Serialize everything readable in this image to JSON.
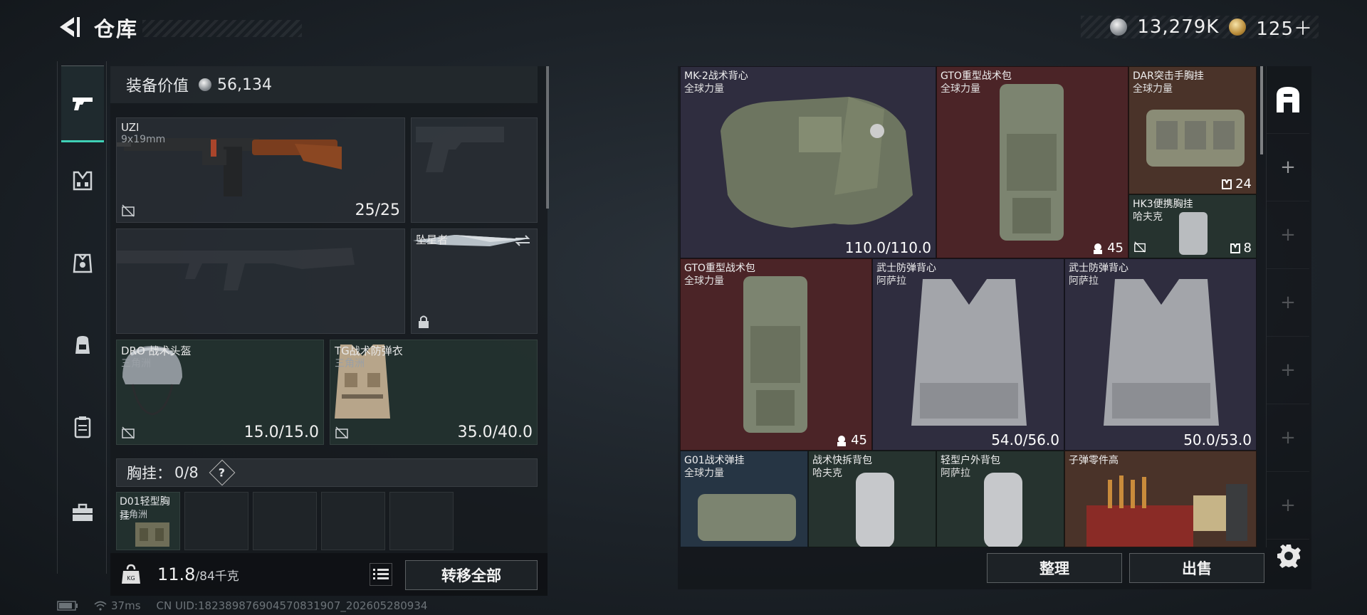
{
  "header": {
    "title": "仓库"
  },
  "currency": {
    "silver": "13,279K",
    "gold": "125＋"
  },
  "loadout": {
    "equip_value_label": "装备价值",
    "equip_value": "56,134",
    "primary": {
      "name": "UZI",
      "caliber": "9x19mm",
      "ammo": "25/25"
    },
    "melee": {
      "name": "坠星者"
    },
    "helmet": {
      "name": "DRO 战术头盔",
      "maker": "三角洲",
      "durability": "15.0/15.0"
    },
    "armor": {
      "name": "TG战术防弹衣",
      "maker": "三角洲",
      "durability": "35.0/40.0"
    },
    "chest_rig": {
      "label": "胸挂：",
      "capacity": "0/8",
      "help": "?"
    },
    "chest_item": {
      "name": "D01轻型胸挂",
      "maker": "三角洲"
    },
    "weight": {
      "current": "11.8",
      "max": "/84千克"
    },
    "transfer_all": "转移全部"
  },
  "stash": {
    "items": [
      {
        "name": "MK-2战术背心",
        "maker": "全球力量",
        "value": "110.0/110.0"
      },
      {
        "name": "GTO重型战术包",
        "maker": "全球力量",
        "value": "45"
      },
      {
        "name": "DAR突击手胸挂",
        "maker": "全球力量",
        "value": "24"
      },
      {
        "name": "HK3便携胸挂",
        "maker": "哈夫克",
        "value": "8"
      },
      {
        "name": "GTO重型战术包",
        "maker": "全球力量",
        "value": "45"
      },
      {
        "name": "武士防弹背心",
        "maker": "阿萨拉",
        "value": "54.0/56.0"
      },
      {
        "name": "武士防弹背心",
        "maker": "阿萨拉",
        "value": "50.0/53.0"
      },
      {
        "name": "G01战术弹挂",
        "maker": "全球力量",
        "value": ""
      },
      {
        "name": "战术快拆背包",
        "maker": "哈夫克",
        "value": ""
      },
      {
        "name": "轻型户外背包",
        "maker": "阿萨拉",
        "value": ""
      },
      {
        "name": "子弹零件高",
        "maker": "",
        "value": ""
      }
    ],
    "organize": "整理",
    "sell": "出售"
  },
  "status": {
    "ping": "37ms",
    "uid": "CN UID:18238987690457083190​7_202605280934"
  },
  "icons": {
    "tabs": [
      "pistol-icon",
      "rig-icon",
      "armor-icon",
      "backpack-icon",
      "case-icon",
      "toolbox-icon"
    ],
    "accent": "#3fd0b6"
  }
}
